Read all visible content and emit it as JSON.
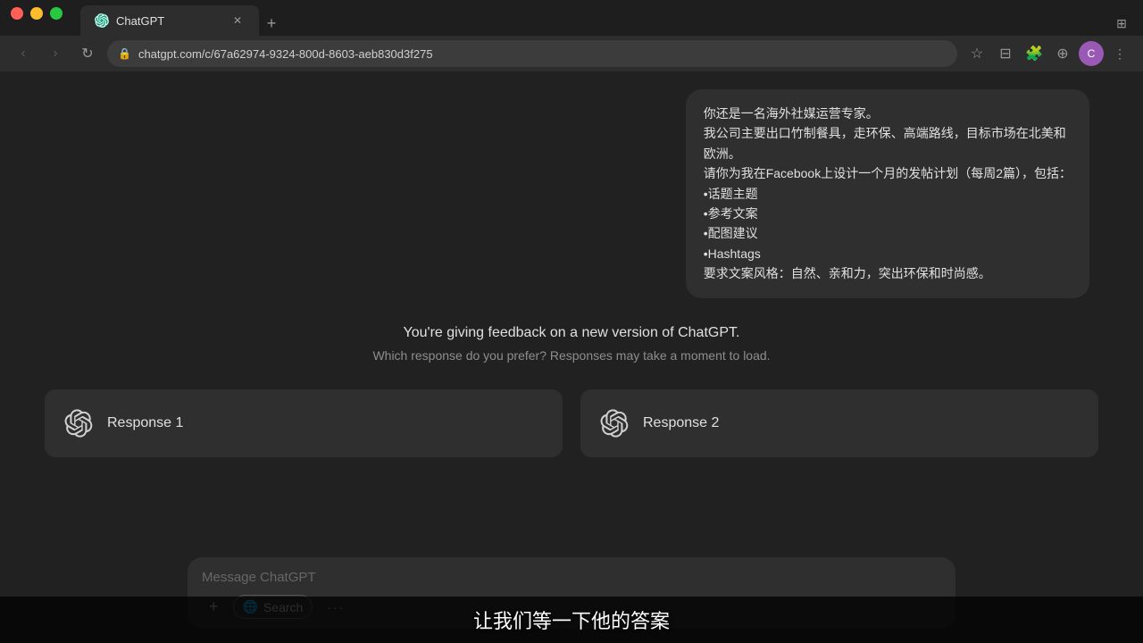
{
  "browser": {
    "tab_title": "ChatGPT",
    "url": "chatgpt.com/c/67a62974-9324-800d-8603-aeb830d3f275",
    "favicon_letter": "C"
  },
  "message": {
    "line1": "你还是一名海外社媒运营专家。",
    "line2": "我公司主要出口竹制餐具，走环保、高端路线，目标市场在北美和",
    "line3": "欧洲。",
    "line4": "请你为我在Facebook上设计一个月的发帖计划（每周2篇），包括：",
    "bullet1": "•话题主题",
    "bullet2": "•参考文案",
    "bullet3": "•配图建议",
    "bullet4": "•Hashtags",
    "line5": "要求文案风格：自然、亲和力，突出环保和时尚感。"
  },
  "feedback": {
    "title": "You're giving feedback on a new version of ChatGPT.",
    "subtitle": "Which response do you prefer? Responses may take a moment to load."
  },
  "responses": [
    {
      "label": "Response 1"
    },
    {
      "label": "Response 2"
    }
  ],
  "input": {
    "placeholder": "Message ChatGPT",
    "add_icon": "+",
    "search_label": "Search",
    "more_icon": "···"
  },
  "subtitle": {
    "text": "让我们等一下他的答案"
  }
}
